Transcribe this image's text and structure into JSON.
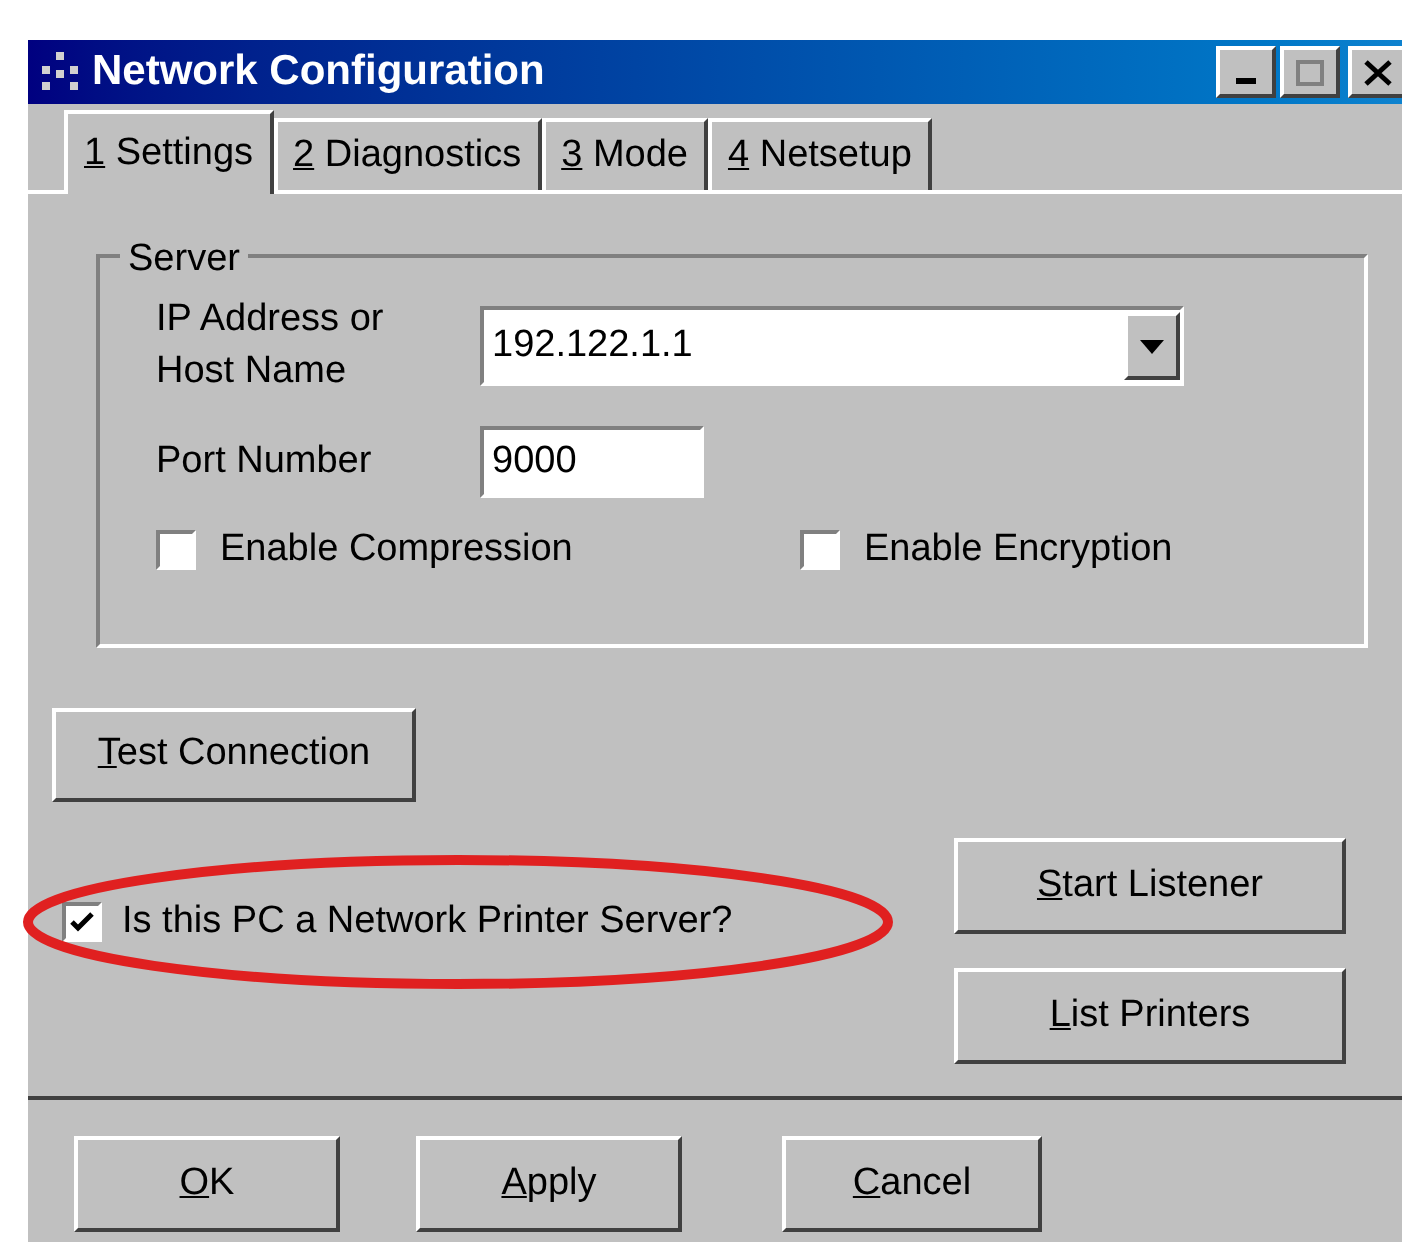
{
  "window": {
    "title": "Network Configuration"
  },
  "tabs": [
    {
      "hotkey": "1",
      "rest": " Settings",
      "selected": true
    },
    {
      "hotkey": "2",
      "rest": " Diagnostics",
      "selected": false
    },
    {
      "hotkey": "3",
      "rest": " Mode",
      "selected": false
    },
    {
      "hotkey": "4",
      "rest": " Netsetup",
      "selected": false
    }
  ],
  "server_group": {
    "title": "Server",
    "host": {
      "label_lines": [
        "IP Address or",
        "Host Name"
      ],
      "value": "192.122.1.1"
    },
    "port": {
      "label": "Port Number",
      "value": "9000"
    },
    "options": [
      {
        "label": "Enable Compression",
        "checked": false
      },
      {
        "label": "Enable Encryption",
        "checked": false
      }
    ]
  },
  "test_button": {
    "hotkey": "T",
    "rest": "est Connection"
  },
  "printer_server": {
    "label": "Is this PC a Network Printer Server?",
    "checked": true,
    "highlighted": true
  },
  "side_buttons": [
    {
      "hotkey": "S",
      "rest": "tart Listener"
    },
    {
      "hotkey": "L",
      "rest": "ist Printers"
    }
  ],
  "footer_buttons": [
    {
      "hotkey": "O",
      "rest": "K"
    },
    {
      "hotkey": "A",
      "rest": "pply"
    },
    {
      "hotkey": "C",
      "rest": "ancel"
    }
  ]
}
